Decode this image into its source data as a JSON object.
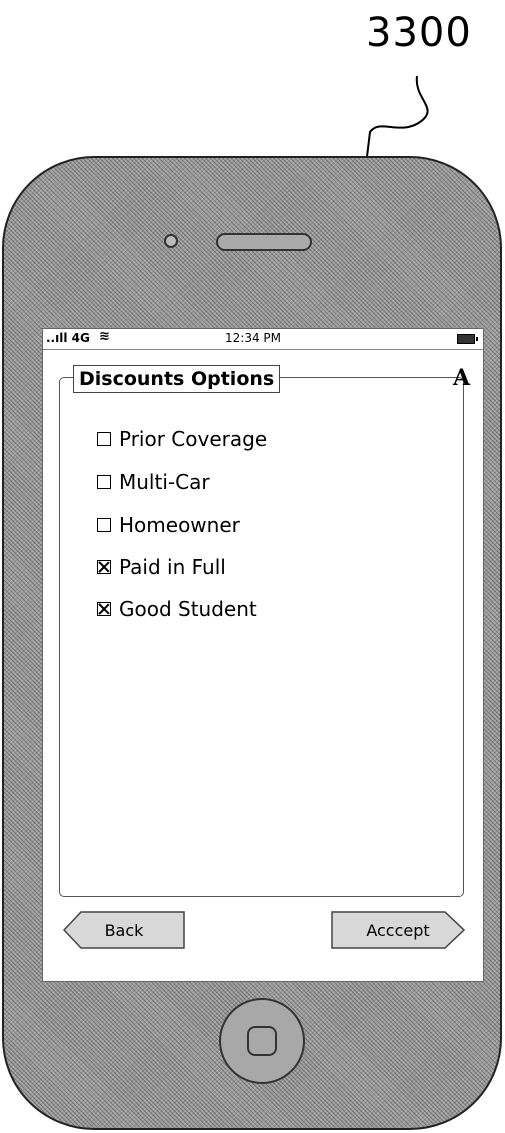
{
  "figure": {
    "reference_number": "3300"
  },
  "status_bar": {
    "signal": "..ıll 4G",
    "wifi_icon": "wifi-icon",
    "time": "12:34 PM"
  },
  "panel": {
    "title": "Discounts Options",
    "corner_label": "A",
    "options": [
      {
        "label": "Prior Coverage",
        "checked": false
      },
      {
        "label": "Multi-Car",
        "checked": false
      },
      {
        "label": "Homeowner",
        "checked": false
      },
      {
        "label": "Paid in Full",
        "checked": true
      },
      {
        "label": "Good Student",
        "checked": true
      }
    ]
  },
  "buttons": {
    "back": "Back",
    "accept": "Acccept"
  }
}
